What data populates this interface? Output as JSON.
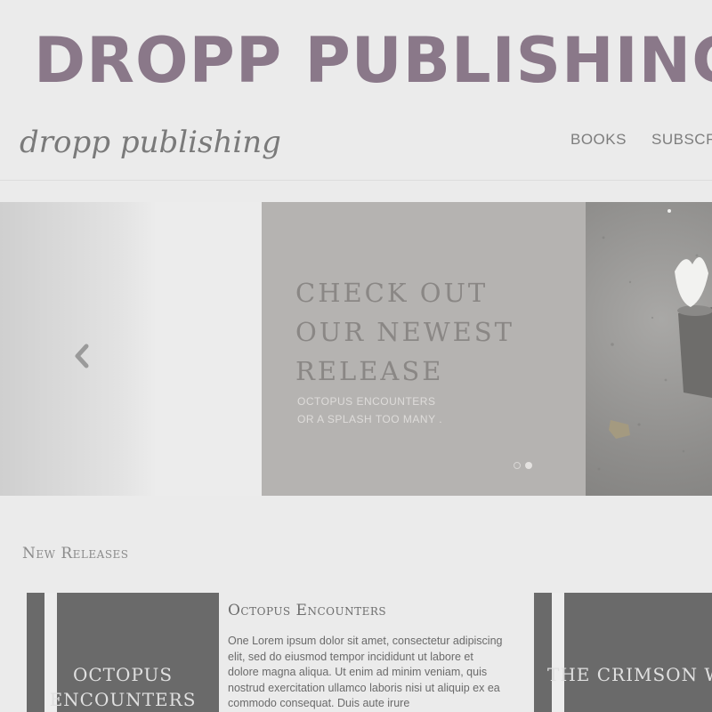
{
  "banner": {
    "title": "DROPP PUBLISHING"
  },
  "header": {
    "logo": "dropp publishing",
    "nav": [
      {
        "label": "BOOKS"
      },
      {
        "label": "SUBSCRI"
      }
    ]
  },
  "hero": {
    "heading_lines": [
      "CHECK OUT",
      "OUR NEWEST",
      "RELEASE"
    ],
    "subtitle_lines": [
      "OCTOPUS ENCOUNTERS",
      "OR A SPLASH TOO MANY ."
    ],
    "slides": {
      "count": 2,
      "active": 2
    }
  },
  "new_releases": {
    "title": "New Releases",
    "books": [
      {
        "cover_lines": [
          "OCTOPUS",
          "ENCOUNTERS"
        ],
        "title": "Octopus Encounters",
        "description": "One Lorem ipsum dolor sit amet, consectetur adipiscing elit, sed do eiusmod tempor incididunt ut labore et dolore magna aliqua. Ut enim ad minim veniam, quis nostrud exercitation ullamco laboris nisi ut aliquip ex ea commodo consequat. Duis aute irure"
      },
      {
        "cover_lines": [
          "THE CRIMSON WAY"
        ]
      }
    ]
  },
  "colors": {
    "banner_text": "#8a7889",
    "hero_panel": "#b5b3b1",
    "cover": "#6a6a6a",
    "background": "#ebebeb"
  }
}
